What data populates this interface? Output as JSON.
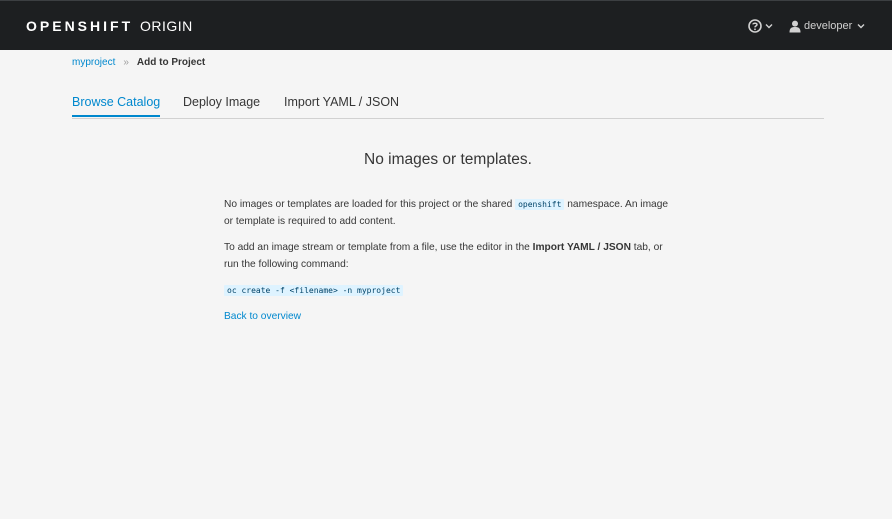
{
  "header": {
    "brand_bold": "OPENSHIFT",
    "brand_light": "ORIGIN",
    "help_icon": "question-circle-icon",
    "user_icon": "user-icon",
    "username": "developer"
  },
  "breadcrumb": {
    "project": "myproject",
    "current": "Add to Project"
  },
  "tabs": [
    {
      "label": "Browse Catalog",
      "active": true
    },
    {
      "label": "Deploy Image",
      "active": false
    },
    {
      "label": "Import YAML / JSON",
      "active": false
    }
  ],
  "empty_state": {
    "title": "No images or templates.",
    "p1_before": "No images or templates are loaded for this project or the shared ",
    "p1_code": "openshift",
    "p1_after": " namespace. An image or template is required to add content.",
    "p2_before": "To add an image stream or template from a file, use the editor in the ",
    "p2_bold": "Import YAML / JSON",
    "p2_after": " tab, or run the following command:",
    "command": "oc create -f <filename> -n myproject",
    "back_link": "Back to overview"
  },
  "colors": {
    "navbar": "#1d1f21",
    "link": "#0088ce",
    "background": "#f5f5f5"
  }
}
